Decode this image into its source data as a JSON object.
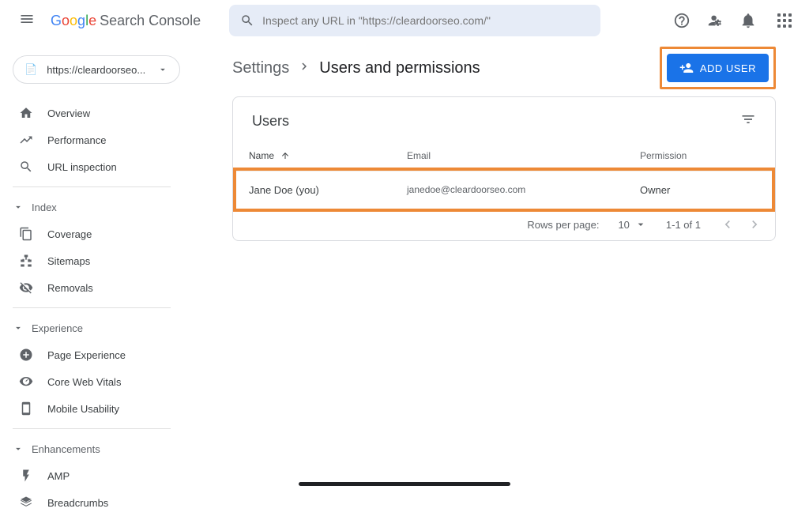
{
  "header": {
    "app_name": "Search Console",
    "search_placeholder": "Inspect any URL in \"https://cleardoorseo.com/\""
  },
  "sidebar": {
    "property_label": "https://cleardoorseo...",
    "items_top": [
      {
        "label": "Overview"
      },
      {
        "label": "Performance"
      },
      {
        "label": "URL inspection"
      }
    ],
    "section_index": {
      "title": "Index",
      "items": [
        {
          "label": "Coverage"
        },
        {
          "label": "Sitemaps"
        },
        {
          "label": "Removals"
        }
      ]
    },
    "section_experience": {
      "title": "Experience",
      "items": [
        {
          "label": "Page Experience"
        },
        {
          "label": "Core Web Vitals"
        },
        {
          "label": "Mobile Usability"
        }
      ]
    },
    "section_enhancements": {
      "title": "Enhancements",
      "items": [
        {
          "label": "AMP"
        },
        {
          "label": "Breadcrumbs"
        }
      ]
    }
  },
  "breadcrumb": {
    "parent": "Settings",
    "current": "Users and permissions"
  },
  "add_user_label": "ADD USER",
  "card": {
    "title": "Users",
    "columns": {
      "name": "Name",
      "email": "Email",
      "permission": "Permission"
    },
    "rows": [
      {
        "name": "Jane Doe (you)",
        "email": "janedoe@cleardoorseo.com",
        "permission": "Owner"
      }
    ],
    "paginator": {
      "rows_label": "Rows per page:",
      "rows_value": "10",
      "range": "1-1 of 1"
    }
  }
}
